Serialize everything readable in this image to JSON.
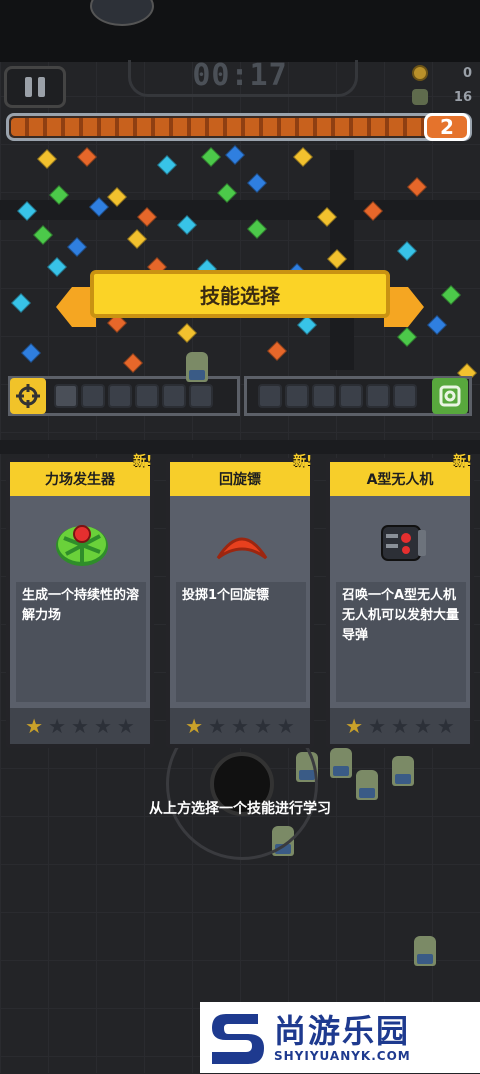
{
  "hud": {
    "timer": "00:17",
    "coins": "0",
    "kills": "16",
    "level": "2",
    "xp_progress": 0.93
  },
  "banner": {
    "title": "技能选择"
  },
  "skill_cards": [
    {
      "new_label": "新!",
      "name": "力场发生器",
      "desc": "生成一个持续性的溶解力场",
      "icon": "force-field-icon",
      "stars_filled": 1,
      "stars_total": 5
    },
    {
      "new_label": "新!",
      "name": "回旋镖",
      "desc": "投掷1个回旋镖",
      "icon": "boomerang-icon",
      "stars_filled": 1,
      "stars_total": 5
    },
    {
      "new_label": "新!",
      "name": "A型无人机",
      "desc": "召唤一个A型无人机\n无人机可以发射大量导弹",
      "icon": "drone-icon",
      "stars_filled": 1,
      "stars_total": 5
    }
  ],
  "hint": "从上方选择一个技能进行学习",
  "watermark": {
    "cn": "尚游乐园",
    "en": "SHYIYUANYK.COM"
  },
  "colors": {
    "card_header": "#f7ce2a",
    "banner": "#fbd326",
    "xp_fill": "#c8611d",
    "star_filled": "#c9a12a",
    "star_empty": "#2c3038"
  }
}
